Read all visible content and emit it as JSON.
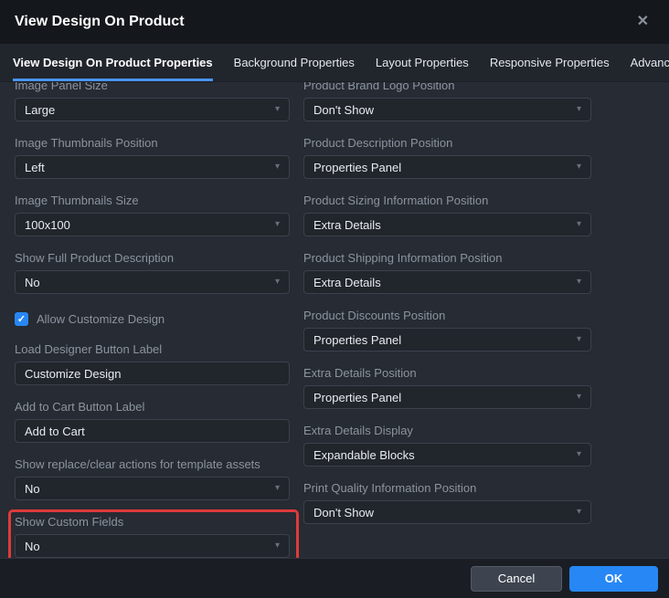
{
  "modal": {
    "title": "View Design On Product"
  },
  "icons": {
    "close": "✕",
    "caret": "▾",
    "check": "✓"
  },
  "tabs": [
    {
      "label": "View Design On Product Properties",
      "active": true
    },
    {
      "label": "Background Properties",
      "active": false
    },
    {
      "label": "Layout Properties",
      "active": false
    },
    {
      "label": "Responsive Properties",
      "active": false
    },
    {
      "label": "Advanced",
      "active": false
    }
  ],
  "form": {
    "left": [
      {
        "label": "Image Panel Size",
        "type": "select",
        "value": "Large"
      },
      {
        "label": "Image Thumbnails Position",
        "type": "select",
        "value": "Left"
      },
      {
        "label": "Image Thumbnails Size",
        "type": "select",
        "value": "100x100"
      },
      {
        "label": "Show Full Product Description",
        "type": "select",
        "value": "No"
      },
      {
        "label": "Allow Customize Design",
        "type": "checkbox",
        "checked": true
      },
      {
        "label": "Load Designer Button Label",
        "type": "text",
        "value": "Customize Design"
      },
      {
        "label": "Add to Cart Button Label",
        "type": "text",
        "value": "Add to Cart"
      },
      {
        "label": "Show replace/clear actions for template assets",
        "type": "select",
        "value": "No"
      },
      {
        "label": "Show Custom Fields",
        "type": "select",
        "value": "No",
        "highlighted": true
      }
    ],
    "right": [
      {
        "label": "Product Brand Logo Position",
        "type": "select",
        "value": "Don't Show"
      },
      {
        "label": "Product Description Position",
        "type": "select",
        "value": "Properties Panel"
      },
      {
        "label": "Product Sizing Information Position",
        "type": "select",
        "value": "Extra Details"
      },
      {
        "label": "Product Shipping Information Position",
        "type": "select",
        "value": "Extra Details"
      },
      {
        "label": "Product Discounts Position",
        "type": "select",
        "value": "Properties Panel"
      },
      {
        "label": "Extra Details Position",
        "type": "select",
        "value": "Properties Panel"
      },
      {
        "label": "Extra Details Display",
        "type": "select",
        "value": "Expandable Blocks"
      },
      {
        "label": "Print Quality Information Position",
        "type": "select",
        "value": "Don't Show"
      }
    ]
  },
  "footer": {
    "cancel_label": "Cancel",
    "ok_label": "OK"
  },
  "colors": {
    "accent_blue": "#2787f5",
    "highlight_red": "#dd3b3b",
    "active_tab_underline": "#4a94f0"
  }
}
